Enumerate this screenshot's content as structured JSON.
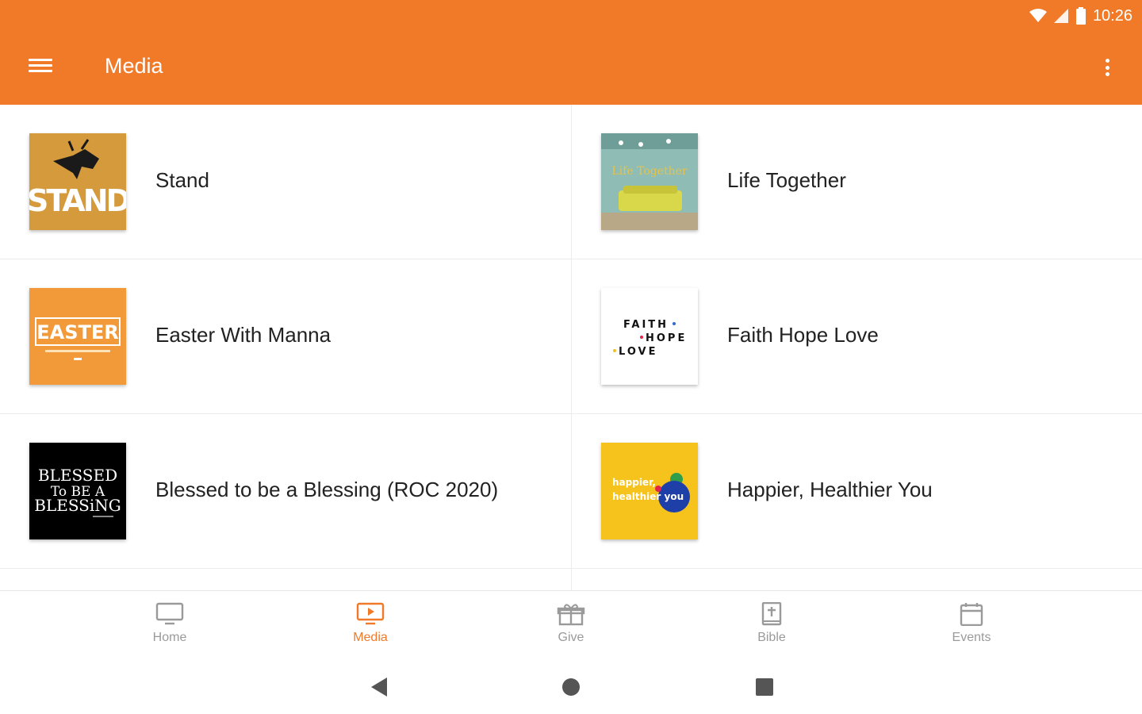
{
  "status_bar": {
    "time": "10:26"
  },
  "app_bar": {
    "title": "Media"
  },
  "media": [
    {
      "label": "Stand",
      "thumb_text": "STAND",
      "thumb_bg": "#D49A3C"
    },
    {
      "label": "Life Together",
      "thumb_text": "Life Together",
      "thumb_bg": "#8FBDB5"
    },
    {
      "label": "Easter With Manna",
      "thumb_text": "EASTER",
      "thumb_bg": "#F29A3A"
    },
    {
      "label": "Faith Hope Love",
      "thumb_text": [
        "FAITH",
        "HOPE",
        "LOVE"
      ],
      "thumb_bg": "#FFFFFF"
    },
    {
      "label": "Blessed to be a Blessing (ROC 2020)",
      "thumb_text": [
        "BLESSED",
        "To BE A",
        "BLESSiNG"
      ],
      "thumb_bg": "#000000"
    },
    {
      "label": "Happier, Healthier You",
      "thumb_text": [
        "happier,",
        "healthier you"
      ],
      "thumb_bg": "#F6C21C"
    }
  ],
  "bottom_nav": [
    {
      "label": "Home",
      "icon": "monitor-icon",
      "active": false
    },
    {
      "label": "Media",
      "icon": "play-screen-icon",
      "active": true
    },
    {
      "label": "Give",
      "icon": "gift-icon",
      "active": false
    },
    {
      "label": "Bible",
      "icon": "bible-icon",
      "active": false
    },
    {
      "label": "Events",
      "icon": "calendar-icon",
      "active": false
    }
  ],
  "colors": {
    "accent": "#F07A28",
    "text": "#222222",
    "inactive": "#9A9A9A"
  }
}
